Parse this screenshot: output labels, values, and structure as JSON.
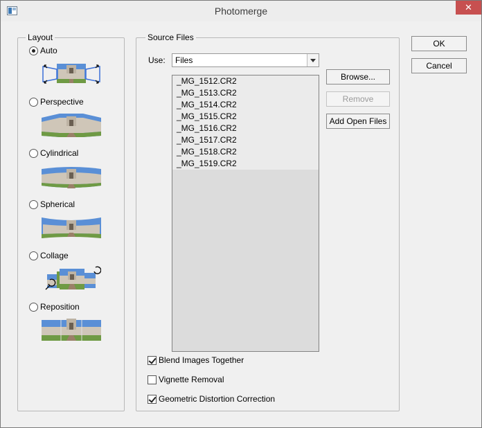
{
  "window": {
    "title": "Photomerge",
    "close_glyph": "✕",
    "app_icon": "photoshop-dialog-icon"
  },
  "layout": {
    "title": "Layout",
    "options": [
      {
        "id": "auto",
        "label": "Auto",
        "checked": true
      },
      {
        "id": "perspective",
        "label": "Perspective",
        "checked": false
      },
      {
        "id": "cylindrical",
        "label": "Cylindrical",
        "checked": false
      },
      {
        "id": "spherical",
        "label": "Spherical",
        "checked": false
      },
      {
        "id": "collage",
        "label": "Collage",
        "checked": false
      },
      {
        "id": "reposition",
        "label": "Reposition",
        "checked": false
      }
    ]
  },
  "source": {
    "title": "Source Files",
    "use_label": "Use:",
    "use_value": "Files",
    "files": [
      "_MG_1512.CR2",
      "_MG_1513.CR2",
      "_MG_1514.CR2",
      "_MG_1515.CR2",
      "_MG_1516.CR2",
      "_MG_1517.CR2",
      "_MG_1518.CR2",
      "_MG_1519.CR2"
    ],
    "browse_label": "Browse...",
    "remove_label": "Remove",
    "add_open_label": "Add Open Files"
  },
  "options": {
    "blend_label": "Blend Images Together",
    "blend_checked": true,
    "vignette_label": "Vignette Removal",
    "vignette_checked": false,
    "geometric_label": "Geometric Distortion Correction",
    "geometric_checked": true
  },
  "buttons": {
    "ok_label": "OK",
    "cancel_label": "Cancel"
  },
  "colors": {
    "sky": "#5a8fd6",
    "building": "#cfc6b8",
    "grass": "#6f9a44",
    "path": "#9a8068",
    "selection": "#3a6fd8"
  }
}
